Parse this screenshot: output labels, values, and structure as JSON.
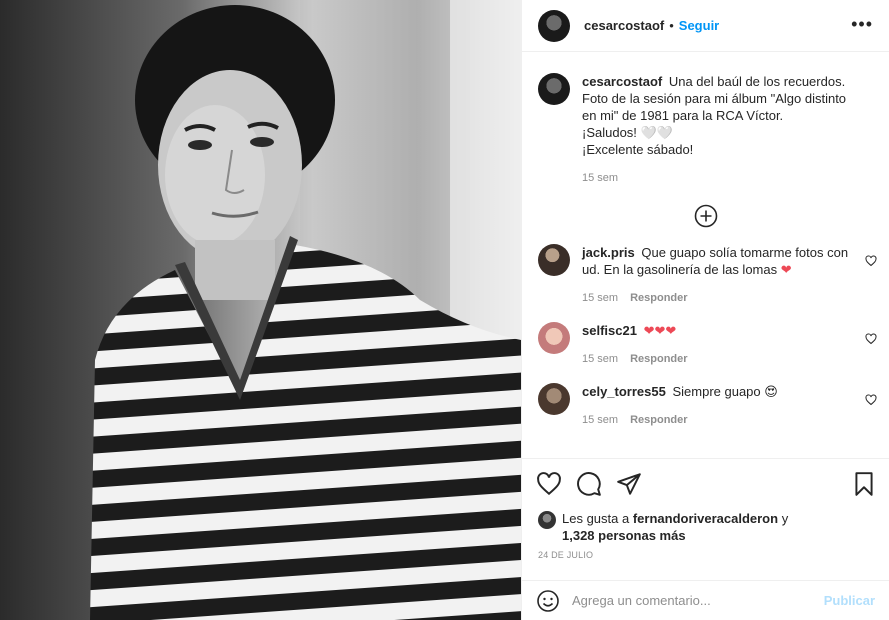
{
  "post": {
    "username": "cesarcostaof",
    "follow_label": "Seguir",
    "separator": "•",
    "more_label": "•••"
  },
  "caption": {
    "username": "cesarcostaof",
    "line1": "Una del baúl de los recuerdos. Foto de la sesión para mi álbum \"Algo distinto en mi\" de 1981 para la RCA Víctor.",
    "line2": "¡Saludos! 🤍🤍",
    "line3": "¡Excelente sábado!",
    "time": "15 sem"
  },
  "comments": [
    {
      "username": "jack.pris",
      "text": "Que guapo solía tomarme fotos con ud. En la gasolinería de las lomas",
      "emoji": "❤",
      "time": "15 sem",
      "reply": "Responder"
    },
    {
      "username": "selfisc21",
      "text": "",
      "emoji": "❤❤❤",
      "time": "15 sem",
      "reply": "Responder"
    },
    {
      "username": "cely_torres55",
      "text": "Siempre guapo",
      "emoji": "😍",
      "time": "15 sem",
      "reply": "Responder"
    }
  ],
  "likes": {
    "prefix": "Les gusta a",
    "user": "fernandoriveracalderon",
    "and": "y",
    "count_text": "1,328 personas más"
  },
  "date": "24 DE JULIO",
  "comment_input": {
    "placeholder": "Agrega un comentario...",
    "publish_label": "Publicar"
  },
  "colors": {
    "link": "#0095f6",
    "publish_disabled": "#b2dffc",
    "heart": "#ed4956",
    "muted": "#8e8e8e",
    "text": "#262626"
  },
  "icons": [
    "heart-icon",
    "comment-icon",
    "share-icon",
    "bookmark-icon",
    "add-circle-icon",
    "emoji-icon",
    "more-icon"
  ]
}
